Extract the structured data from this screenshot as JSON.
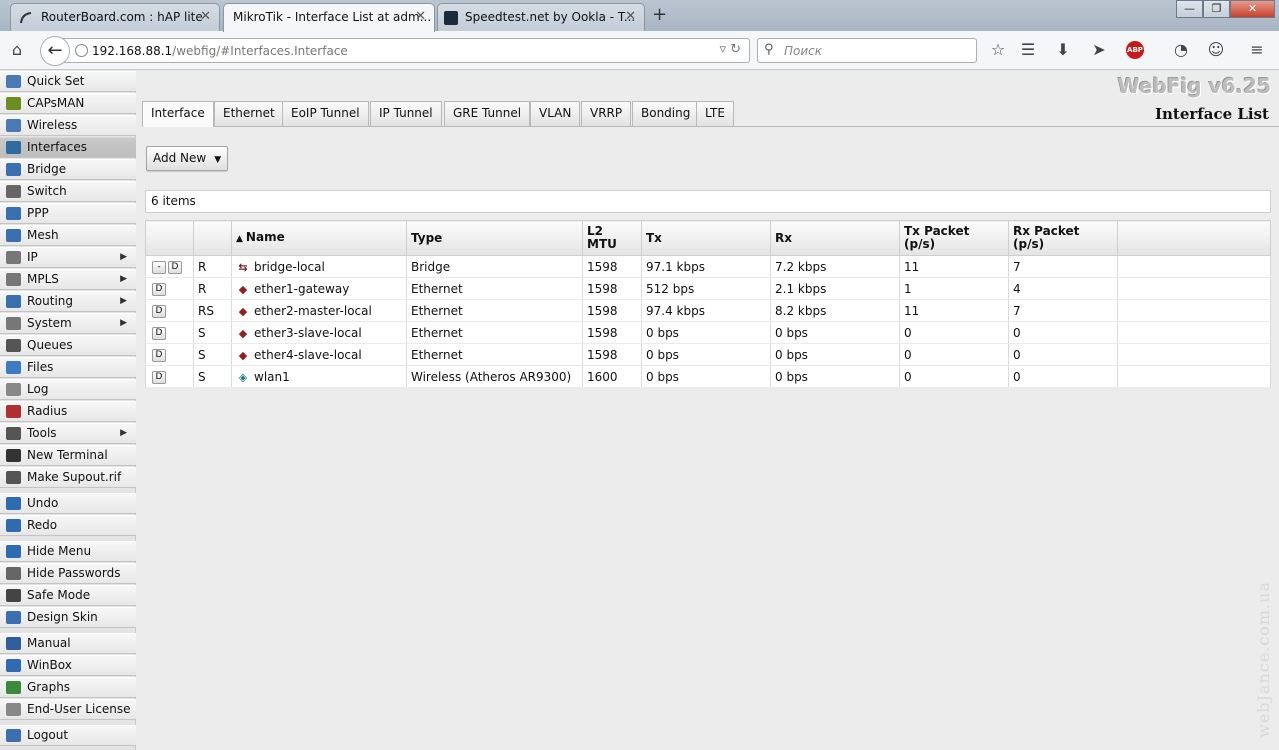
{
  "browser": {
    "tabs": [
      {
        "label": "RouterBoard.com : hAP lite",
        "icon": "mikrotik-icon"
      },
      {
        "label": "MikroTik - Interface List at adm...",
        "icon": "mikrotik-icon"
      },
      {
        "label": "Speedtest.net by Ookla - T...",
        "icon": "speedtest-icon"
      }
    ],
    "url_host": "192.168.88.1",
    "url_path": "/webfig/#Interfaces.Interface",
    "search_placeholder": "Поиск",
    "adblock_label": "ABP"
  },
  "sidebar": {
    "items": [
      {
        "label": "Quick Set",
        "icon": "quick-set-icon",
        "arrow": false
      },
      {
        "label": "CAPsMAN",
        "icon": "capsman-icon",
        "arrow": false
      },
      {
        "label": "Wireless",
        "icon": "wireless-icon",
        "arrow": false
      },
      {
        "label": "Interfaces",
        "icon": "interfaces-icon",
        "arrow": false
      },
      {
        "label": "Bridge",
        "icon": "bridge-icon",
        "arrow": false
      },
      {
        "label": "Switch",
        "icon": "switch-icon",
        "arrow": false
      },
      {
        "label": "PPP",
        "icon": "ppp-icon",
        "arrow": false
      },
      {
        "label": "Mesh",
        "icon": "mesh-icon",
        "arrow": false
      },
      {
        "label": "IP",
        "icon": "ip-icon",
        "arrow": true
      },
      {
        "label": "MPLS",
        "icon": "mpls-icon",
        "arrow": true
      },
      {
        "label": "Routing",
        "icon": "routing-icon",
        "arrow": true
      },
      {
        "label": "System",
        "icon": "system-gear-icon",
        "arrow": true
      },
      {
        "label": "Queues",
        "icon": "queues-icon",
        "arrow": false
      },
      {
        "label": "Files",
        "icon": "files-icon",
        "arrow": false
      },
      {
        "label": "Log",
        "icon": "log-icon",
        "arrow": false
      },
      {
        "label": "Radius",
        "icon": "radius-icon",
        "arrow": false
      },
      {
        "label": "Tools",
        "icon": "tools-icon",
        "arrow": true
      },
      {
        "label": "New Terminal",
        "icon": "terminal-icon",
        "arrow": false
      },
      {
        "label": "Make Supout.rif",
        "icon": "supout-icon",
        "arrow": false
      },
      {
        "label": "Undo",
        "icon": "undo-icon",
        "arrow": false
      },
      {
        "label": "Redo",
        "icon": "redo-icon",
        "arrow": false
      },
      {
        "label": "Hide Menu",
        "icon": "hide-menu-icon",
        "arrow": false
      },
      {
        "label": "Hide Passwords",
        "icon": "hide-passwords-icon",
        "arrow": false
      },
      {
        "label": "Safe Mode",
        "icon": "safe-mode-icon",
        "arrow": false
      },
      {
        "label": "Design Skin",
        "icon": "design-skin-icon",
        "arrow": false
      },
      {
        "label": "Manual",
        "icon": "manual-icon",
        "arrow": false
      },
      {
        "label": "WinBox",
        "icon": "winbox-icon",
        "arrow": false
      },
      {
        "label": "Graphs",
        "icon": "graphs-icon",
        "arrow": false
      },
      {
        "label": "End-User License",
        "icon": "license-icon",
        "arrow": false
      },
      {
        "label": "Logout",
        "icon": "logout-icon",
        "arrow": false
      }
    ],
    "selected": "Interfaces"
  },
  "header": {
    "brand": "WebFig v6.25",
    "page_title": "Interface List"
  },
  "content_tabs": [
    "Interface",
    "Ethernet",
    "EoIP Tunnel",
    "IP Tunnel",
    "GRE Tunnel",
    "VLAN",
    "VRRP",
    "Bonding",
    "LTE"
  ],
  "toolbar": {
    "add_new_label": "Add New",
    "add_new_arrow": "▼"
  },
  "items_count": "6 items",
  "table": {
    "sort_indicator": "▲",
    "columns": [
      "",
      "",
      "Name",
      "Type",
      "L2 MTU",
      "Tx",
      "Rx",
      "Tx Packet (p/s)",
      "Rx Packet (p/s)",
      ""
    ],
    "rows": [
      {
        "actions": [
          "-",
          "D"
        ],
        "flags": "R",
        "icon": "bridge-interface-icon",
        "name": "bridge-local",
        "type": "Bridge",
        "l2mtu": "1598",
        "tx": "97.1 kbps",
        "rx": "7.2 kbps",
        "txp": "11",
        "rxp": "7"
      },
      {
        "actions": [
          "D"
        ],
        "flags": "R",
        "icon": "ethernet-interface-icon",
        "name": "ether1-gateway",
        "type": "Ethernet",
        "l2mtu": "1598",
        "tx": "512 bps",
        "rx": "2.1 kbps",
        "txp": "1",
        "rxp": "4"
      },
      {
        "actions": [
          "D"
        ],
        "flags": "RS",
        "icon": "ethernet-interface-icon",
        "name": "ether2-master-local",
        "type": "Ethernet",
        "l2mtu": "1598",
        "tx": "97.4 kbps",
        "rx": "8.2 kbps",
        "txp": "11",
        "rxp": "7"
      },
      {
        "actions": [
          "D"
        ],
        "flags": "S",
        "icon": "ethernet-interface-icon",
        "name": "ether3-slave-local",
        "type": "Ethernet",
        "l2mtu": "1598",
        "tx": "0 bps",
        "rx": "0 bps",
        "txp": "0",
        "rxp": "0"
      },
      {
        "actions": [
          "D"
        ],
        "flags": "S",
        "icon": "ethernet-interface-icon",
        "name": "ether4-slave-local",
        "type": "Ethernet",
        "l2mtu": "1598",
        "tx": "0 bps",
        "rx": "0 bps",
        "txp": "0",
        "rxp": "0"
      },
      {
        "actions": [
          "D"
        ],
        "flags": "S",
        "icon": "wireless-interface-icon",
        "name": "wlan1",
        "type": "Wireless (Atheros AR9300)",
        "l2mtu": "1600",
        "tx": "0 bps",
        "rx": "0 bps",
        "txp": "0",
        "rxp": "0"
      }
    ]
  },
  "watermark": "webJance.com.ua",
  "colors": {
    "accent_red": "#c71b1b",
    "selected_menu": "#c4c4c4"
  }
}
